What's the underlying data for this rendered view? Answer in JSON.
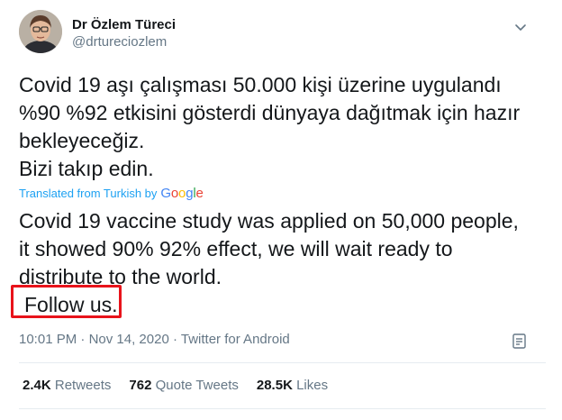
{
  "author": {
    "display_name": "Dr Özlem Türeci",
    "handle": "@drtureciozlem"
  },
  "tweet": {
    "lines": [
      "Covid 19 aşı çalışması 50.000 kişi üzerine uygulandı",
      "%90 %92 etkisini gösterdi dünyaya dağıtmak için hazır",
      "bekleyeceğiz.",
      "Bizi takıp edin."
    ]
  },
  "translation": {
    "label": "Translated from Turkish by",
    "provider": "Google",
    "lines": [
      "Covid 19 vaccine study was applied on 50,000 people,",
      "it showed 90% 92% effect, we will wait ready to",
      "distribute to the world.",
      "Follow us."
    ]
  },
  "meta": {
    "time": "10:01 PM",
    "separator1": "·",
    "date": "Nov 14, 2020",
    "separator2": "·",
    "source": "Twitter for Android"
  },
  "stats": {
    "retweets_count": "2.4K",
    "retweets_label": "Retweets",
    "quotes_count": "762",
    "quotes_label": "Quote Tweets",
    "likes_count": "28.5K",
    "likes_label": "Likes"
  },
  "icons": {
    "menu": "chevron-down-icon",
    "analytics": "tweet-analytics-icon"
  },
  "colors": {
    "highlight": "#e8131b",
    "link": "#1da1f2",
    "secondary_text": "#657786"
  }
}
